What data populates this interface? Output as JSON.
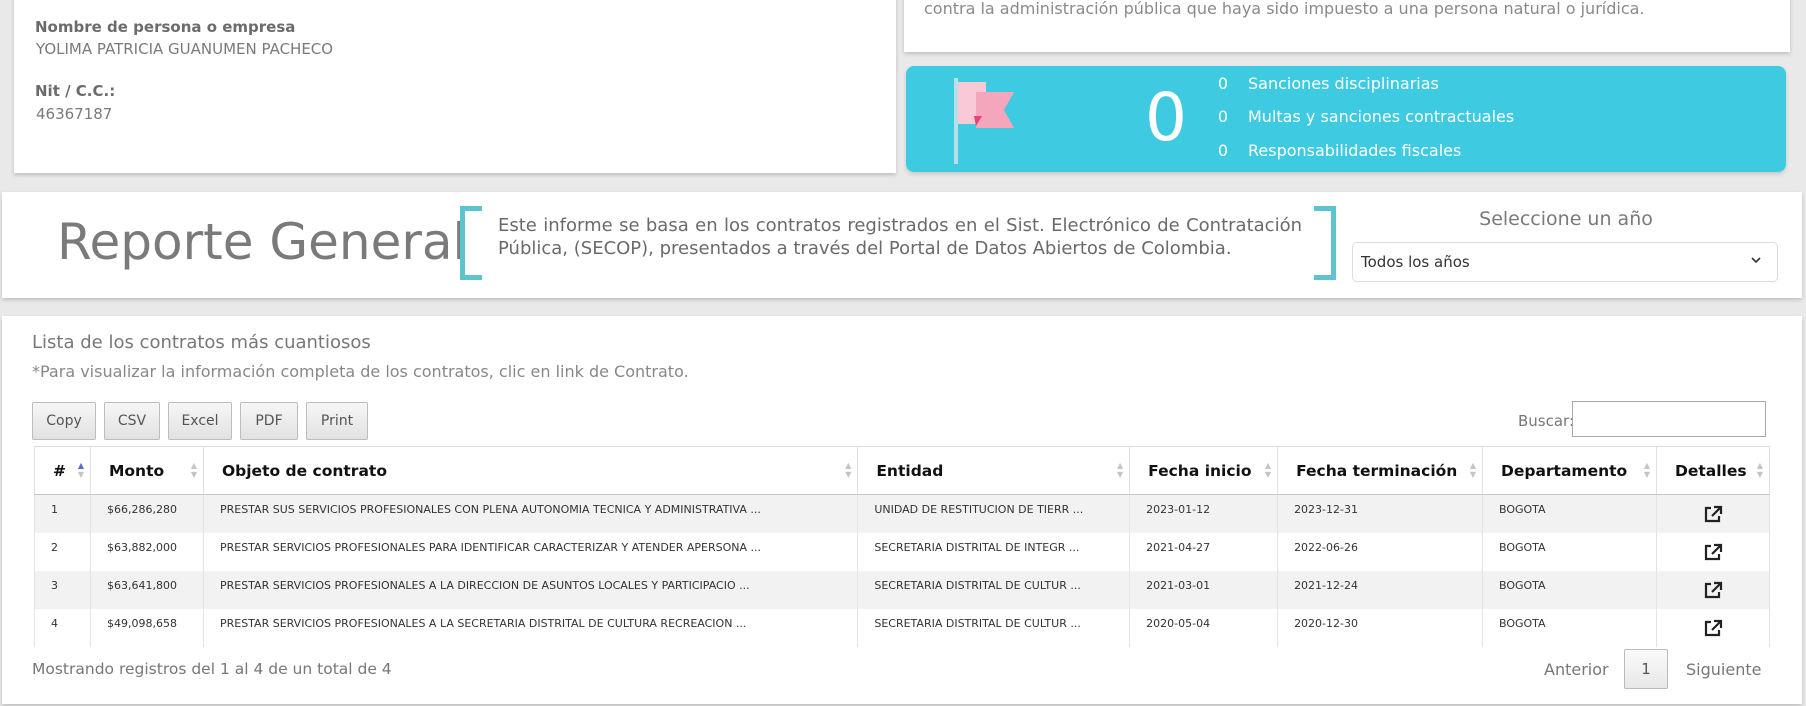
{
  "person": {
    "name_label": "Nombre de persona o empresa",
    "name_value": "YOLIMA PATRICIA GUANUMEN PACHECO",
    "id_label": "Nit / C.C.:",
    "id_value": "46367187"
  },
  "sanctions": {
    "note": "Los siguientes datos relacionan el histórico de sanciones, multas o cualquier otro reporte por delitos contra la administración pública que haya sido impuesto a una persona natural o jurídica.",
    "total": "0",
    "items": [
      {
        "count": "0",
        "label": "Sanciones disciplinarias"
      },
      {
        "count": "0",
        "label": "Multas y sanciones contractuales"
      },
      {
        "count": "0",
        "label": "Responsabilidades fiscales"
      }
    ]
  },
  "report": {
    "title": "Reporte General",
    "description": "Este informe se basa en los contratos registrados en el Sist. Electrónico de Contratación Pública, (SECOP), presentados a través del Portal de Datos Abiertos de Colombia.",
    "year_label": "Seleccione un año",
    "year_selected": "Todos los años"
  },
  "contracts": {
    "title": "Lista de los contratos más cuantiosos",
    "note": "*Para visualizar la información completa de los contratos, clic en link de Contrato.",
    "buttons": [
      "Copy",
      "CSV",
      "Excel",
      "PDF",
      "Print"
    ],
    "search_label": "Buscar:",
    "columns": [
      "#",
      "Monto",
      "Objeto de contrato",
      "Entidad",
      "Fecha inicio",
      "Fecha terminación",
      "Departamento",
      "Detalles"
    ],
    "rows": [
      [
        "1",
        "$66,286,280",
        "PRESTAR SUS SERVICIOS PROFESIONALES CON PLENA AUTONOMIA TECNICA Y ADMINISTRATIVA ...",
        "UNIDAD DE RESTITUCION DE TIERR ...",
        "2023-01-12",
        "2023-12-31",
        "BOGOTA"
      ],
      [
        "2",
        "$63,882,000",
        "PRESTAR SERVICIOS PROFESIONALES PARA IDENTIFICAR CARACTERIZAR Y ATENDER APERSONA ...",
        "SECRETARIA DISTRITAL DE INTEGR ...",
        "2021-04-27",
        "2022-06-26",
        "BOGOTA"
      ],
      [
        "3",
        "$63,641,800",
        "PRESTAR SERVICIOS PROFESIONALES A LA DIRECCION DE ASUNTOS LOCALES Y PARTICIPACIO ...",
        "SECRETARIA DISTRITAL DE CULTUR ...",
        "2021-03-01",
        "2021-12-24",
        "BOGOTA"
      ],
      [
        "4",
        "$49,098,658",
        "PRESTAR SERVICIOS PROFESIONALES A LA SECRETARIA DISTRITAL DE CULTURA RECREACION ...",
        "SECRETARIA DISTRITAL DE CULTUR ...",
        "2020-05-04",
        "2020-12-30",
        "BOGOTA"
      ]
    ],
    "info": "Mostrando registros del 1 al 4 de un total de 4",
    "prev_label": "Anterior",
    "page": "1",
    "next_label": "Siguiente"
  },
  "colors": {
    "accent": "#3ecbe2",
    "bracket": "#5cc3cf",
    "flag_pink": "#f4a6bd"
  }
}
